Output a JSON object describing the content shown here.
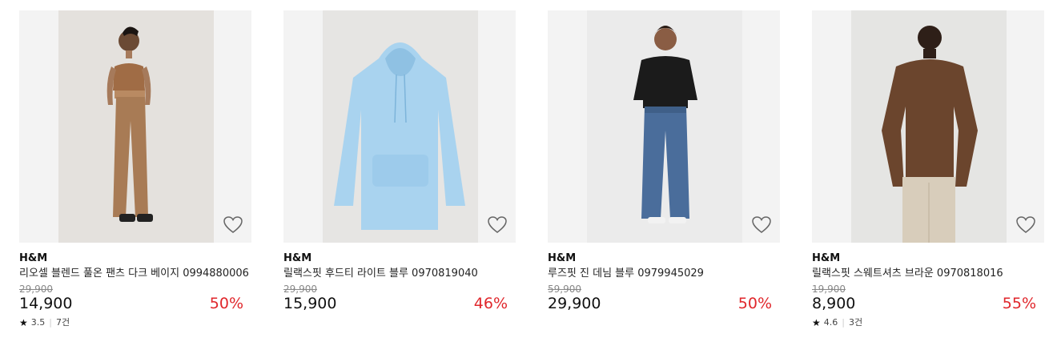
{
  "icons": {
    "wishlist": "heart-outline-icon",
    "rating": "star-icon"
  },
  "colors": {
    "discount": "#e0262b",
    "image_bg": "#f3f3f3"
  },
  "products": [
    {
      "brand": "H&M",
      "title": "리오셀 블렌드 풀온 팬츠 다크 베이지 0994880006",
      "original_price": "29,900",
      "price": "14,900",
      "discount": "50%",
      "rating": "3.5",
      "reviews": "7건"
    },
    {
      "brand": "H&M",
      "title": "릴랙스핏 후드티 라이트 블루 0970819040",
      "original_price": "29,900",
      "price": "15,900",
      "discount": "46%"
    },
    {
      "brand": "H&M",
      "title": "루즈핏 진 데님 블루 0979945029",
      "original_price": "59,900",
      "price": "29,900",
      "discount": "50%"
    },
    {
      "brand": "H&M",
      "title": "릴랙스핏 스웨트셔츠 브라운 0970818016",
      "original_price": "19,900",
      "price": "8,900",
      "discount": "55%",
      "rating": "4.6",
      "reviews": "3건"
    }
  ]
}
